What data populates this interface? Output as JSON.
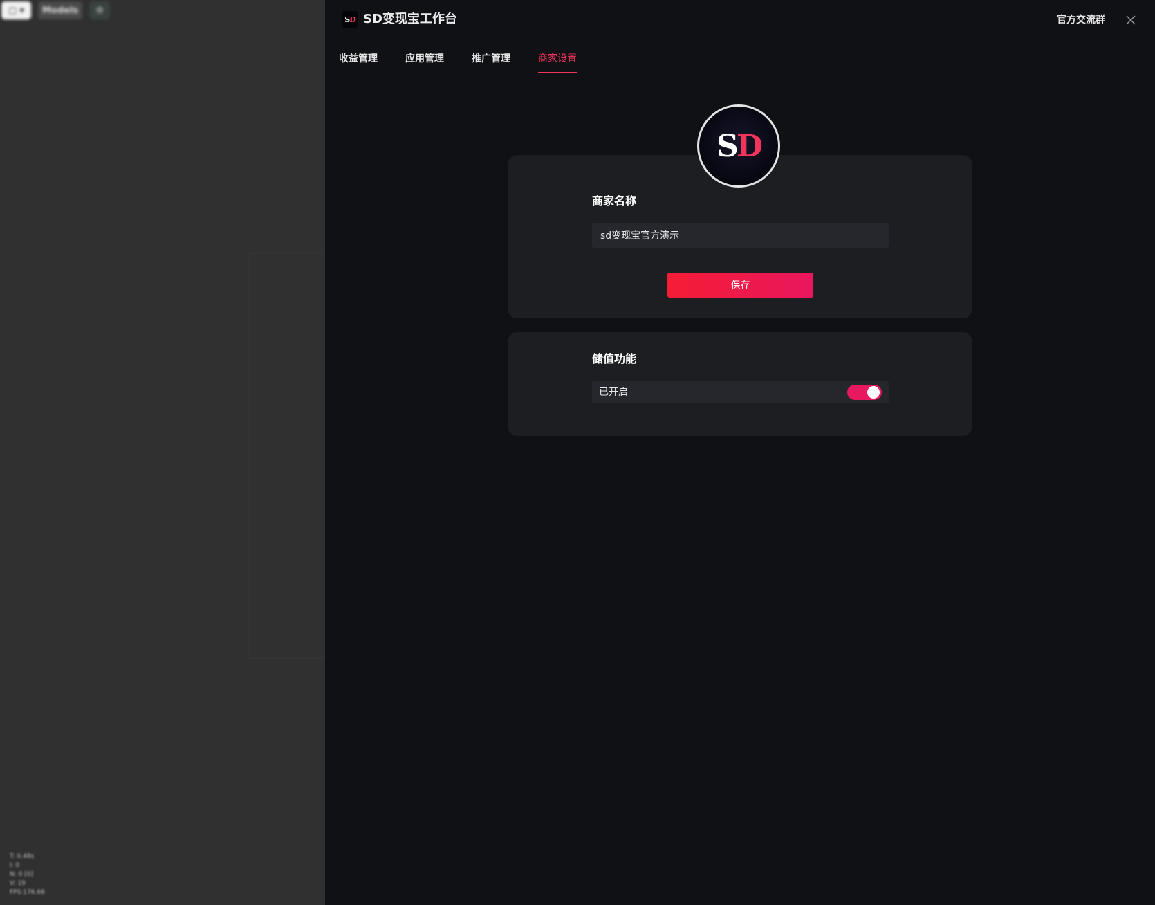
{
  "background_app": {
    "toolbar": {
      "pill_label": "▢ ▾",
      "models_label": "Models",
      "square_label": "⚙"
    },
    "stats": [
      "T: 0.48s",
      "I: 0",
      "N: 0 [0]",
      "V: 19",
      "FPS:176.66"
    ]
  },
  "header": {
    "app_title": "SD变现宝工作台",
    "logo": {
      "s": "S",
      "d": "D"
    },
    "community_link": "官方交流群"
  },
  "tabs": [
    {
      "label": "收益管理",
      "active": false
    },
    {
      "label": "应用管理",
      "active": false
    },
    {
      "label": "推广管理",
      "active": false
    },
    {
      "label": "商家设置",
      "active": true
    }
  ],
  "merchant": {
    "avatar": {
      "s": "S",
      "d": "D"
    },
    "name_label": "商家名称",
    "name_value": "sd变现宝官方演示",
    "save_label": "保存"
  },
  "recharge": {
    "label": "储值功能",
    "status_text": "已开启",
    "enabled": true
  },
  "colors": {
    "accent": "#f0345c",
    "button_gradient_start": "#f51c35",
    "button_gradient_end": "#e8175e",
    "panel_bg": "#101114",
    "card_bg": "#1d1e22"
  }
}
